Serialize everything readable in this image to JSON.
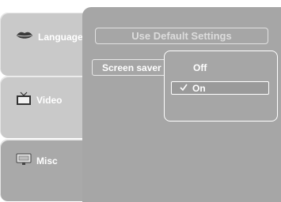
{
  "tabs": [
    {
      "label": "Language",
      "icon": "lips-icon"
    },
    {
      "label": "Video",
      "icon": "tv-icon"
    },
    {
      "label": "Misc",
      "icon": "misc-icon"
    }
  ],
  "panel": {
    "default_button": "Use Default Settings",
    "screen_saver_label": "Screen saver",
    "options": [
      {
        "label": "Off",
        "selected": false
      },
      {
        "label": "On",
        "selected": true
      }
    ]
  },
  "colors": {
    "tab_bg": "#c9c9c9",
    "tab_active_bg": "#a9a9a9",
    "panel_bg": "#a6a6a6",
    "text": "#ffffff"
  }
}
